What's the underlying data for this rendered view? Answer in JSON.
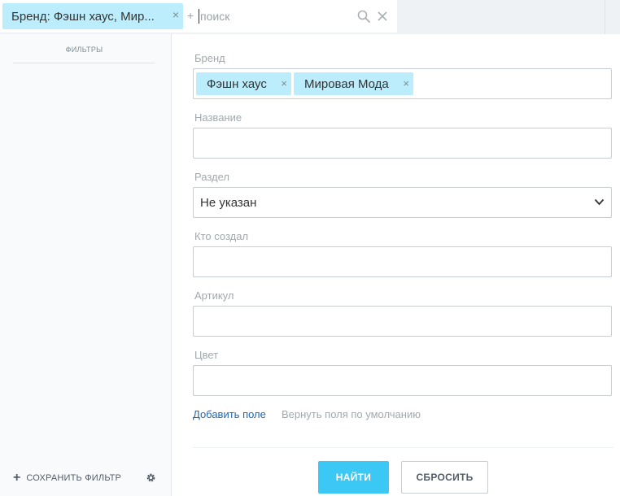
{
  "search": {
    "chip_label": "Бренд: Фэшн хаус, Мир...",
    "chip_close": "×",
    "add_hint": "+",
    "placeholder": "поиск",
    "search_icon": "search-icon",
    "clear_icon": "close-icon"
  },
  "sidebar": {
    "title": "ФИЛЬТРЫ",
    "save_label": "СОХРАНИТЬ ФИЛЬТР",
    "save_icon": "+"
  },
  "form": {
    "fields": [
      {
        "label": "Бренд",
        "type": "tags",
        "tags": [
          "Фэшн хаус",
          "Мировая Мода"
        ]
      },
      {
        "label": "Название",
        "type": "text",
        "value": ""
      },
      {
        "label": "Раздел",
        "type": "select",
        "value": "Не указан"
      },
      {
        "label": "Кто создал",
        "type": "text",
        "value": ""
      },
      {
        "label": "Артикул",
        "type": "text",
        "value": ""
      },
      {
        "label": "Цвет",
        "type": "text",
        "value": ""
      }
    ],
    "tag_close": "×",
    "add_field_link": "Добавить поле",
    "reset_fields_link": "Вернуть поля по умолчанию",
    "find_button": "НАЙТИ",
    "reset_button": "СБРОСИТЬ"
  },
  "colors": {
    "accent": "#3bc8f5",
    "tag_bg": "#bcedfc",
    "link": "#2067b0"
  }
}
